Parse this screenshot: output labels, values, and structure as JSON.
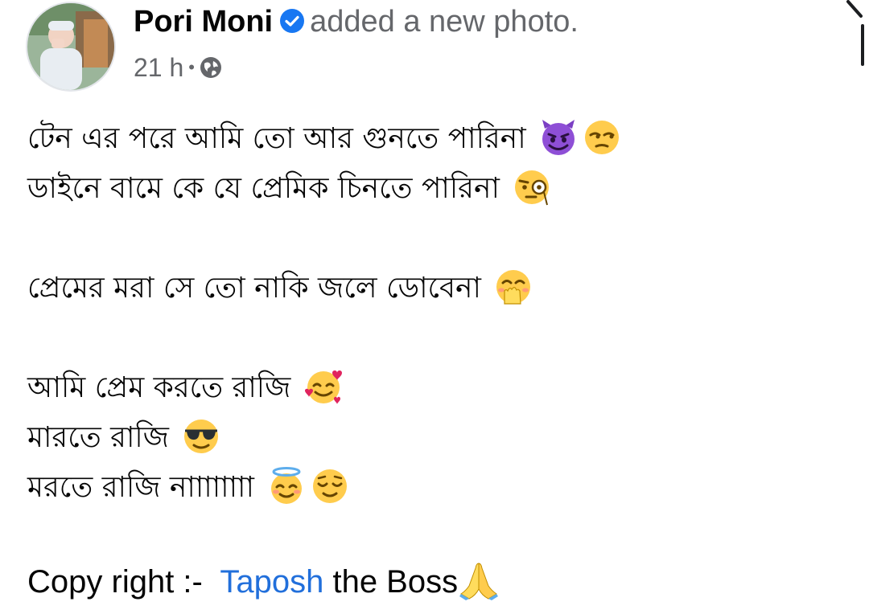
{
  "post": {
    "author": "Pori Moni",
    "action": "added a new photo.",
    "time": "21 h",
    "separator": "•",
    "icons": {
      "verified": "verified-badge-icon",
      "audience": "globe-icon"
    },
    "colors": {
      "verified": "#1877f2",
      "meta": "#65676b",
      "link": "#216fdb"
    }
  },
  "body": {
    "lines": [
      {
        "text": "টেন এর পরে আমি তো আর গুনতে পারিনা",
        "emojis": [
          "smiling-imp-emoji",
          "unamused-emoji"
        ]
      },
      {
        "text": "ডাইনে বামে কে যে প্রেমিক চিনতে পারিনা",
        "emojis": [
          "monocle-emoji"
        ]
      },
      {
        "text": "প্রেমের মরা সে তো নাকি জলে ডোবেনা",
        "emojis": [
          "hand-over-mouth-emoji"
        ]
      },
      {
        "text": "আমি প্রেম করতে রাজি",
        "emojis": [
          "smiling-face-with-hearts-emoji"
        ]
      },
      {
        "text": "মারতে রাজি",
        "emojis": [
          "sunglasses-emoji"
        ]
      },
      {
        "text": "মরতে রাজি নাাাাাাাা",
        "emojis": [
          "halo-emoji",
          "relieved-emoji"
        ]
      }
    ]
  },
  "footer": {
    "prefix": "Copy right :-  ",
    "link": "Taposh",
    "suffix": " the Boss",
    "emoji": "folded-hands-emoji"
  }
}
